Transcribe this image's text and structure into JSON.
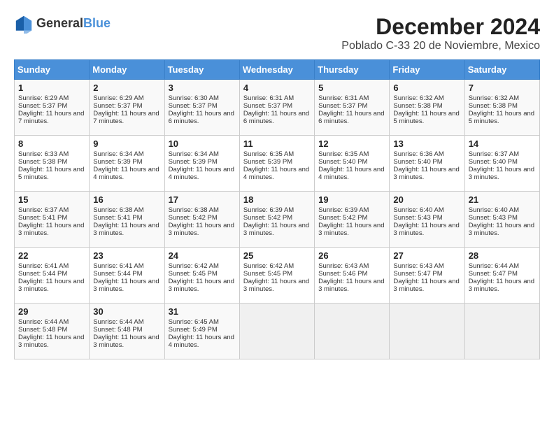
{
  "header": {
    "logo_line1": "General",
    "logo_line2": "Blue",
    "month_title": "December 2024",
    "subtitle": "Poblado C-33 20 de Noviembre, Mexico"
  },
  "weekdays": [
    "Sunday",
    "Monday",
    "Tuesday",
    "Wednesday",
    "Thursday",
    "Friday",
    "Saturday"
  ],
  "weeks": [
    [
      {
        "day": "1",
        "sunrise": "6:29 AM",
        "sunset": "5:37 PM",
        "daylight": "11 hours and 7 minutes."
      },
      {
        "day": "2",
        "sunrise": "6:29 AM",
        "sunset": "5:37 PM",
        "daylight": "11 hours and 7 minutes."
      },
      {
        "day": "3",
        "sunrise": "6:30 AM",
        "sunset": "5:37 PM",
        "daylight": "11 hours and 6 minutes."
      },
      {
        "day": "4",
        "sunrise": "6:31 AM",
        "sunset": "5:37 PM",
        "daylight": "11 hours and 6 minutes."
      },
      {
        "day": "5",
        "sunrise": "6:31 AM",
        "sunset": "5:37 PM",
        "daylight": "11 hours and 6 minutes."
      },
      {
        "day": "6",
        "sunrise": "6:32 AM",
        "sunset": "5:38 PM",
        "daylight": "11 hours and 5 minutes."
      },
      {
        "day": "7",
        "sunrise": "6:32 AM",
        "sunset": "5:38 PM",
        "daylight": "11 hours and 5 minutes."
      }
    ],
    [
      {
        "day": "8",
        "sunrise": "6:33 AM",
        "sunset": "5:38 PM",
        "daylight": "11 hours and 5 minutes."
      },
      {
        "day": "9",
        "sunrise": "6:34 AM",
        "sunset": "5:39 PM",
        "daylight": "11 hours and 4 minutes."
      },
      {
        "day": "10",
        "sunrise": "6:34 AM",
        "sunset": "5:39 PM",
        "daylight": "11 hours and 4 minutes."
      },
      {
        "day": "11",
        "sunrise": "6:35 AM",
        "sunset": "5:39 PM",
        "daylight": "11 hours and 4 minutes."
      },
      {
        "day": "12",
        "sunrise": "6:35 AM",
        "sunset": "5:40 PM",
        "daylight": "11 hours and 4 minutes."
      },
      {
        "day": "13",
        "sunrise": "6:36 AM",
        "sunset": "5:40 PM",
        "daylight": "11 hours and 3 minutes."
      },
      {
        "day": "14",
        "sunrise": "6:37 AM",
        "sunset": "5:40 PM",
        "daylight": "11 hours and 3 minutes."
      }
    ],
    [
      {
        "day": "15",
        "sunrise": "6:37 AM",
        "sunset": "5:41 PM",
        "daylight": "11 hours and 3 minutes."
      },
      {
        "day": "16",
        "sunrise": "6:38 AM",
        "sunset": "5:41 PM",
        "daylight": "11 hours and 3 minutes."
      },
      {
        "day": "17",
        "sunrise": "6:38 AM",
        "sunset": "5:42 PM",
        "daylight": "11 hours and 3 minutes."
      },
      {
        "day": "18",
        "sunrise": "6:39 AM",
        "sunset": "5:42 PM",
        "daylight": "11 hours and 3 minutes."
      },
      {
        "day": "19",
        "sunrise": "6:39 AM",
        "sunset": "5:42 PM",
        "daylight": "11 hours and 3 minutes."
      },
      {
        "day": "20",
        "sunrise": "6:40 AM",
        "sunset": "5:43 PM",
        "daylight": "11 hours and 3 minutes."
      },
      {
        "day": "21",
        "sunrise": "6:40 AM",
        "sunset": "5:43 PM",
        "daylight": "11 hours and 3 minutes."
      }
    ],
    [
      {
        "day": "22",
        "sunrise": "6:41 AM",
        "sunset": "5:44 PM",
        "daylight": "11 hours and 3 minutes."
      },
      {
        "day": "23",
        "sunrise": "6:41 AM",
        "sunset": "5:44 PM",
        "daylight": "11 hours and 3 minutes."
      },
      {
        "day": "24",
        "sunrise": "6:42 AM",
        "sunset": "5:45 PM",
        "daylight": "11 hours and 3 minutes."
      },
      {
        "day": "25",
        "sunrise": "6:42 AM",
        "sunset": "5:45 PM",
        "daylight": "11 hours and 3 minutes."
      },
      {
        "day": "26",
        "sunrise": "6:43 AM",
        "sunset": "5:46 PM",
        "daylight": "11 hours and 3 minutes."
      },
      {
        "day": "27",
        "sunrise": "6:43 AM",
        "sunset": "5:47 PM",
        "daylight": "11 hours and 3 minutes."
      },
      {
        "day": "28",
        "sunrise": "6:44 AM",
        "sunset": "5:47 PM",
        "daylight": "11 hours and 3 minutes."
      }
    ],
    [
      {
        "day": "29",
        "sunrise": "6:44 AM",
        "sunset": "5:48 PM",
        "daylight": "11 hours and 3 minutes."
      },
      {
        "day": "30",
        "sunrise": "6:44 AM",
        "sunset": "5:48 PM",
        "daylight": "11 hours and 3 minutes."
      },
      {
        "day": "31",
        "sunrise": "6:45 AM",
        "sunset": "5:49 PM",
        "daylight": "11 hours and 4 minutes."
      },
      null,
      null,
      null,
      null
    ]
  ]
}
